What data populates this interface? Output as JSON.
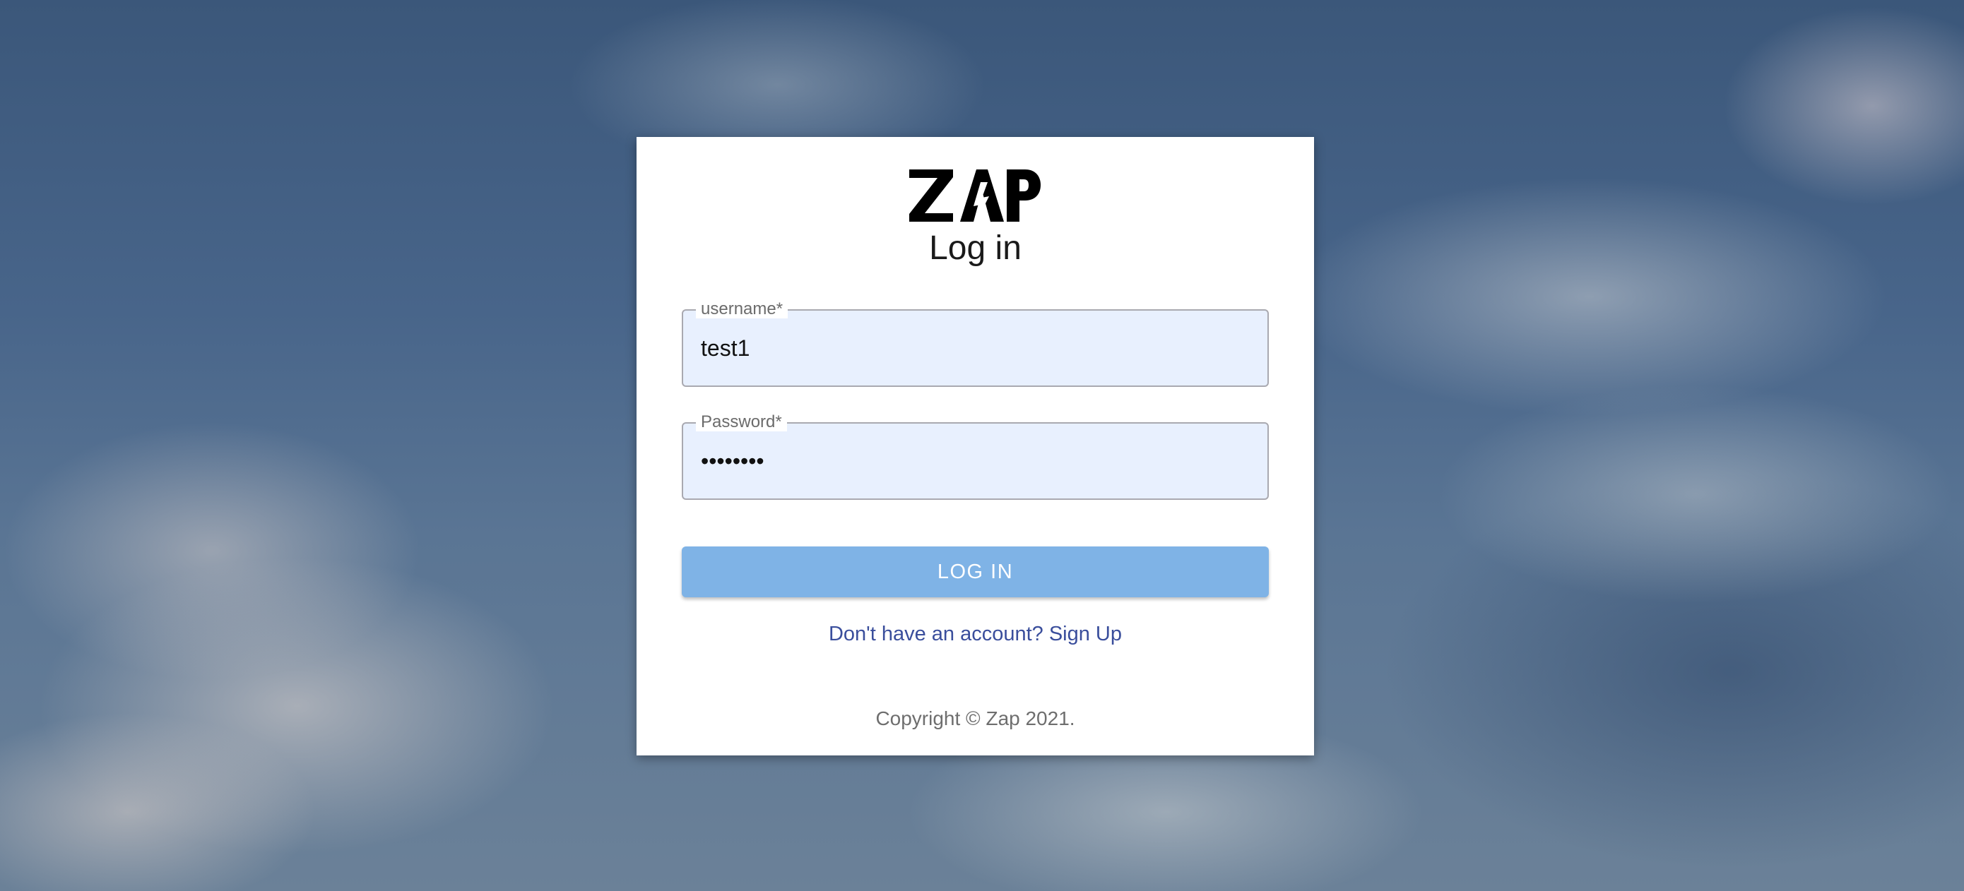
{
  "logo": {
    "text": "ZAP",
    "icon": "lightning-bolt-icon"
  },
  "form": {
    "title": "Log in",
    "username": {
      "label": "username",
      "required_mark": "*",
      "value": "test1"
    },
    "password": {
      "label": "Password",
      "required_mark": "*",
      "value": "••••••••"
    },
    "submit_label": "LOG IN",
    "signup_link": "Don't have an account? Sign Up"
  },
  "footer": {
    "copyright": "Copyright © Zap 2021."
  },
  "colors": {
    "button": "#7fb3e6",
    "input_fill": "#e8f0fe",
    "link": "#3a4e9c"
  }
}
